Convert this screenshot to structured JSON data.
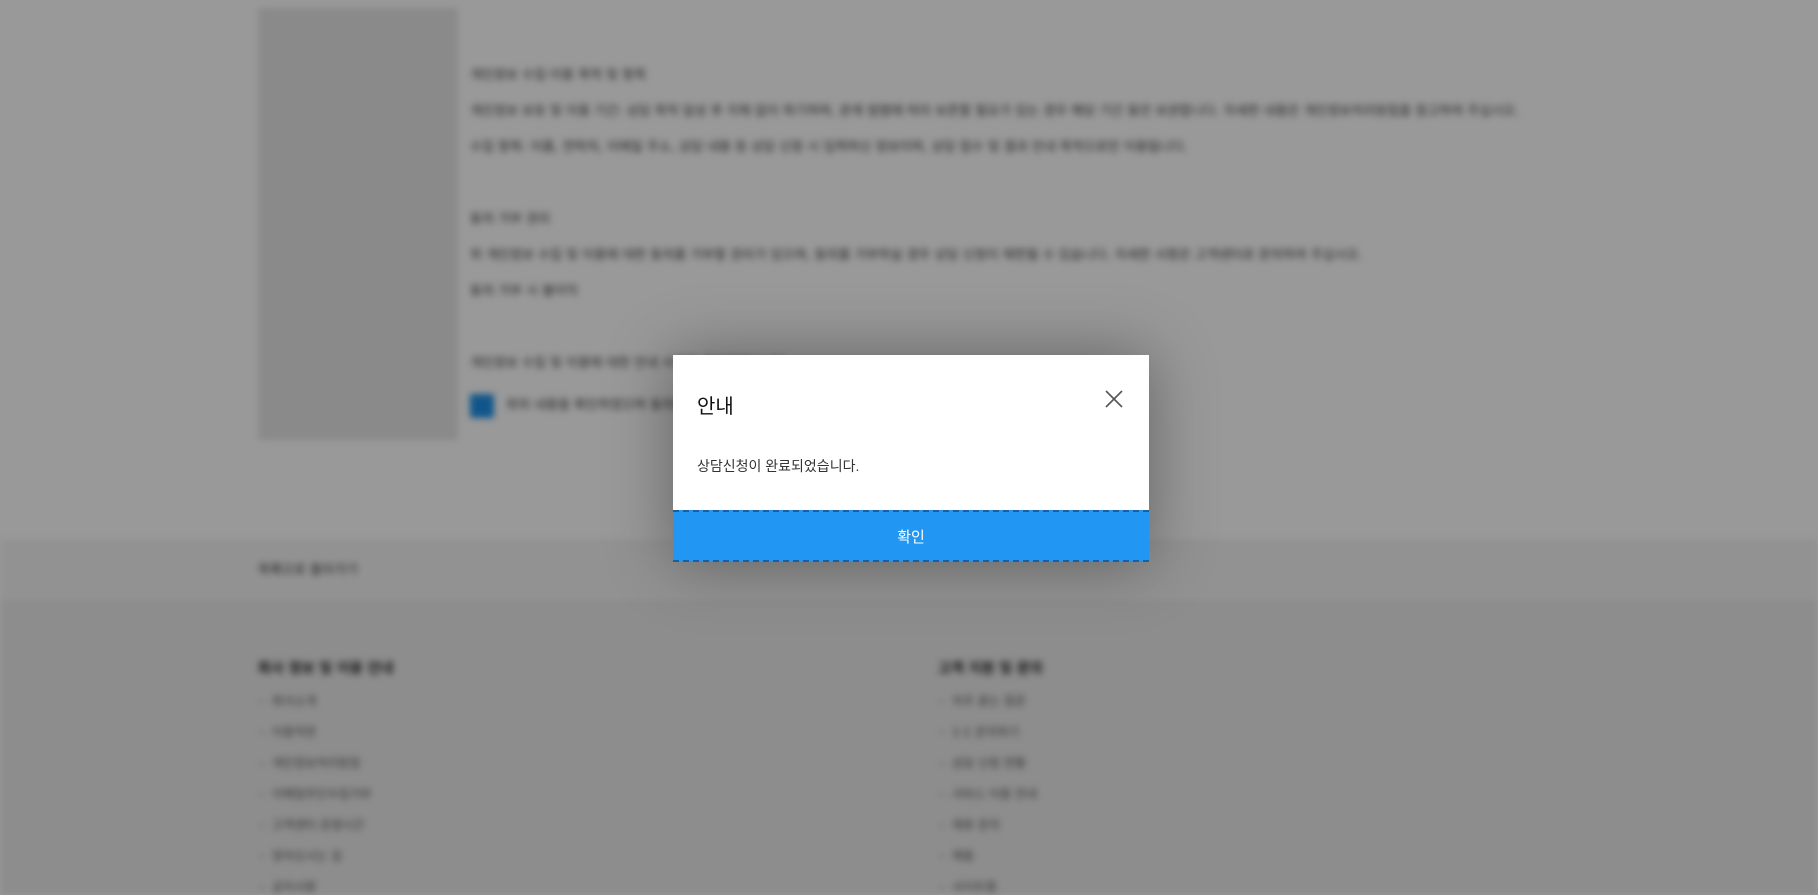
{
  "background": {
    "paragraphs": [
      {
        "heading": "개인정보 수집·이용 목적 및 항목",
        "lines": [
          "개인정보 보유 및 이용 기간: 상담 목적 달성 후 지체 없이 파기하며, 관계 법령에 따라 보존할 필요가 있는 경우 해당 기간 동안 보관합니다. 자세한 내용은 개인정보처리방침을 참고하여 주십시오.",
          "수집 항목: 이름, 연락처, 이메일 주소, 상담 내용 등 상담 신청 시 입력하신 정보이며, 상담 접수 및 결과 안내 목적으로만 이용됩니다."
        ]
      },
      {
        "heading": "동의 거부 권리",
        "lines": [
          "위 개인정보 수집 및 이용에 대한 동의를 거부할 권리가 있으며, 동의를 거부하실 경우 상담 신청이 제한될 수 있습니다. 자세한 사항은 고객센터로 문의하여 주십시오.",
          "동의 거부 시 불이익"
        ]
      }
    ],
    "consent_note": "개인정보 수집 및 이용에 대한 안내 사항을 확인하였습니다.",
    "consent_label": "위의 내용을 확인하였으며 동의합니다",
    "band_text": "목록으로 돌아가기",
    "footer": {
      "left_title": "회사 정보 및 이용 안내",
      "left_items": [
        "회사소개",
        "이용약관",
        "개인정보처리방침",
        "이메일무단수집거부",
        "고객센터 운영시간",
        "찾아오시는 길",
        "공지사항"
      ],
      "right_title": "고객 지원 및 문의",
      "right_items": [
        "자주 묻는 질문",
        "1:1 문의하기",
        "상담 신청 현황",
        "서비스 이용 안내",
        "제휴 문의",
        "채용",
        "사이트맵"
      ]
    }
  },
  "dialog": {
    "title": "안내",
    "message": "상담신청이 완료되었습니다.",
    "confirm_label": "확인",
    "close_icon": "close-icon"
  },
  "colors": {
    "accent": "#2196f3",
    "overlay": "rgba(0,0,0,0.40)",
    "checkbox": "#1d90e8"
  }
}
